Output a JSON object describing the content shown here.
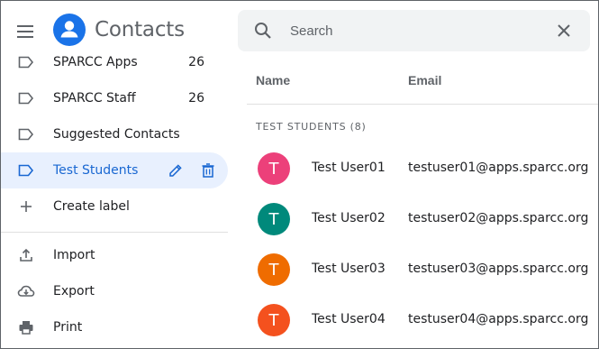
{
  "header": {
    "title": "Contacts"
  },
  "search": {
    "placeholder": "Search"
  },
  "sidebar": {
    "labels": [
      {
        "label": "SPARCC Apps",
        "count": "26"
      },
      {
        "label": "SPARCC Staff",
        "count": "26"
      },
      {
        "label": "Suggested Contacts",
        "count": ""
      },
      {
        "label": "Test Students",
        "count": ""
      }
    ],
    "create_label": "Create label",
    "actions": [
      {
        "label": "Import",
        "icon": "upload-icon"
      },
      {
        "label": "Export",
        "icon": "cloud-download-icon"
      },
      {
        "label": "Print",
        "icon": "printer-icon"
      }
    ]
  },
  "list": {
    "columns": {
      "name": "Name",
      "email": "Email"
    },
    "group_title": "TEST STUDENTS (8)",
    "rows": [
      {
        "initial": "T",
        "name": "Test User01",
        "email": "testuser01@apps.sparcc.org",
        "color": "#ec407a"
      },
      {
        "initial": "T",
        "name": "Test User02",
        "email": "testuser02@apps.sparcc.org",
        "color": "#00897b"
      },
      {
        "initial": "T",
        "name": "Test User03",
        "email": "testuser03@apps.sparcc.org",
        "color": "#ef6c00"
      },
      {
        "initial": "T",
        "name": "Test User04",
        "email": "testuser04@apps.sparcc.org",
        "color": "#f4511e"
      }
    ]
  },
  "colors": {
    "accent": "#1a73e8",
    "active_bg": "#e8f0fe",
    "active_text": "#1967d2",
    "search_bg": "#f1f3f4"
  }
}
